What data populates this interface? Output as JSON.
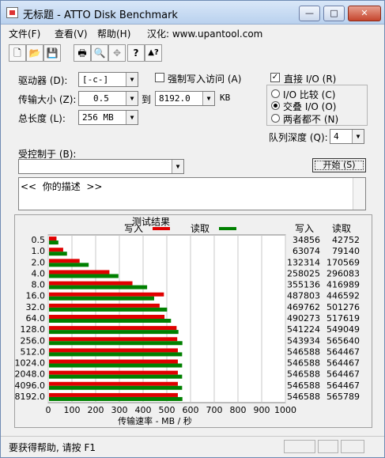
{
  "window": {
    "title": "无标题 - ATTO Disk Benchmark",
    "minimize_label": "—",
    "maximize_label": "□",
    "close_label": "✕"
  },
  "menu": {
    "file": "文件(F)",
    "view": "查看(V)",
    "help": "帮助(H)",
    "localized": "汉化: www.upantool.com"
  },
  "toolbar": {
    "icons": [
      "new-file-icon",
      "open-folder-icon",
      "save-icon",
      "print-icon",
      "print-preview-icon",
      "move-icon",
      "help-icon",
      "context-help-icon"
    ],
    "new_glyph": "🗋",
    "open_glyph": "📂",
    "save_glyph": "💾",
    "print_glyph": "🖶",
    "preview_glyph": "🔍",
    "move_glyph": "✥",
    "help_glyph": "?",
    "context_help_glyph": "▲?"
  },
  "settings": {
    "drive_label": "驱动器 (D):",
    "drive_value": "[-c-]",
    "force_write_label": "强制写入访问 (A)",
    "force_write_checked": false,
    "transfer_size_label": "传输大小 (Z):",
    "transfer_from": "0.5",
    "to_label": "到",
    "transfer_to": "8192.0",
    "transfer_unit": "KB",
    "total_length_label": "总长度 (L):",
    "total_length_value": "256 MB",
    "direct_io_label": "直接 I/O (R)",
    "direct_io_checked": true,
    "io_compare_label": "I/O 比较 (C)",
    "overlapped_io_label": "交叠 I/O (O)",
    "neither_label": "两者都不 (N)",
    "selected_io_mode": "overlapped",
    "queue_depth_label": "队列深度 (Q):",
    "queue_depth_value": "4",
    "controlled_by_label": "受控制于 (B):",
    "controlled_by_value": "",
    "start_button": "开始 (S)",
    "description": "<<  你的描述  >>",
    "check_glyph": "✓",
    "arrow_glyph": "▼"
  },
  "chart_data": {
    "type": "bar",
    "orientation": "horizontal",
    "title": "测试结果",
    "xlabel": "传输速率 - MB / 秒",
    "xlim": [
      0,
      1000
    ],
    "xticks": [
      0,
      100,
      200,
      300,
      400,
      500,
      600,
      700,
      800,
      900,
      1000
    ],
    "grid": true,
    "legend_placement": "top",
    "categories": [
      "0.5",
      "1.0",
      "2.0",
      "4.0",
      "8.0",
      "16.0",
      "32.0",
      "64.0",
      "128.0",
      "256.0",
      "512.0",
      "1024.0",
      "2048.0",
      "4096.0",
      "8192.0"
    ],
    "series": [
      {
        "name": "写入",
        "color": "#e00000",
        "values": [
          34856,
          63074,
          132314,
          258025,
          355136,
          487803,
          469762,
          490273,
          541224,
          543934,
          546588,
          546588,
          546588,
          546588,
          546588
        ]
      },
      {
        "name": "读取",
        "color": "#008000",
        "values": [
          42752,
          79140,
          170569,
          296083,
          416989,
          446592,
          501276,
          517619,
          549049,
          565640,
          564467,
          564467,
          564467,
          564467,
          565789
        ]
      }
    ],
    "value_unit_divisor": 1000,
    "table_headers": [
      "写入",
      "读取"
    ]
  },
  "status": {
    "text": "要获得帮助, 请按 F1"
  }
}
